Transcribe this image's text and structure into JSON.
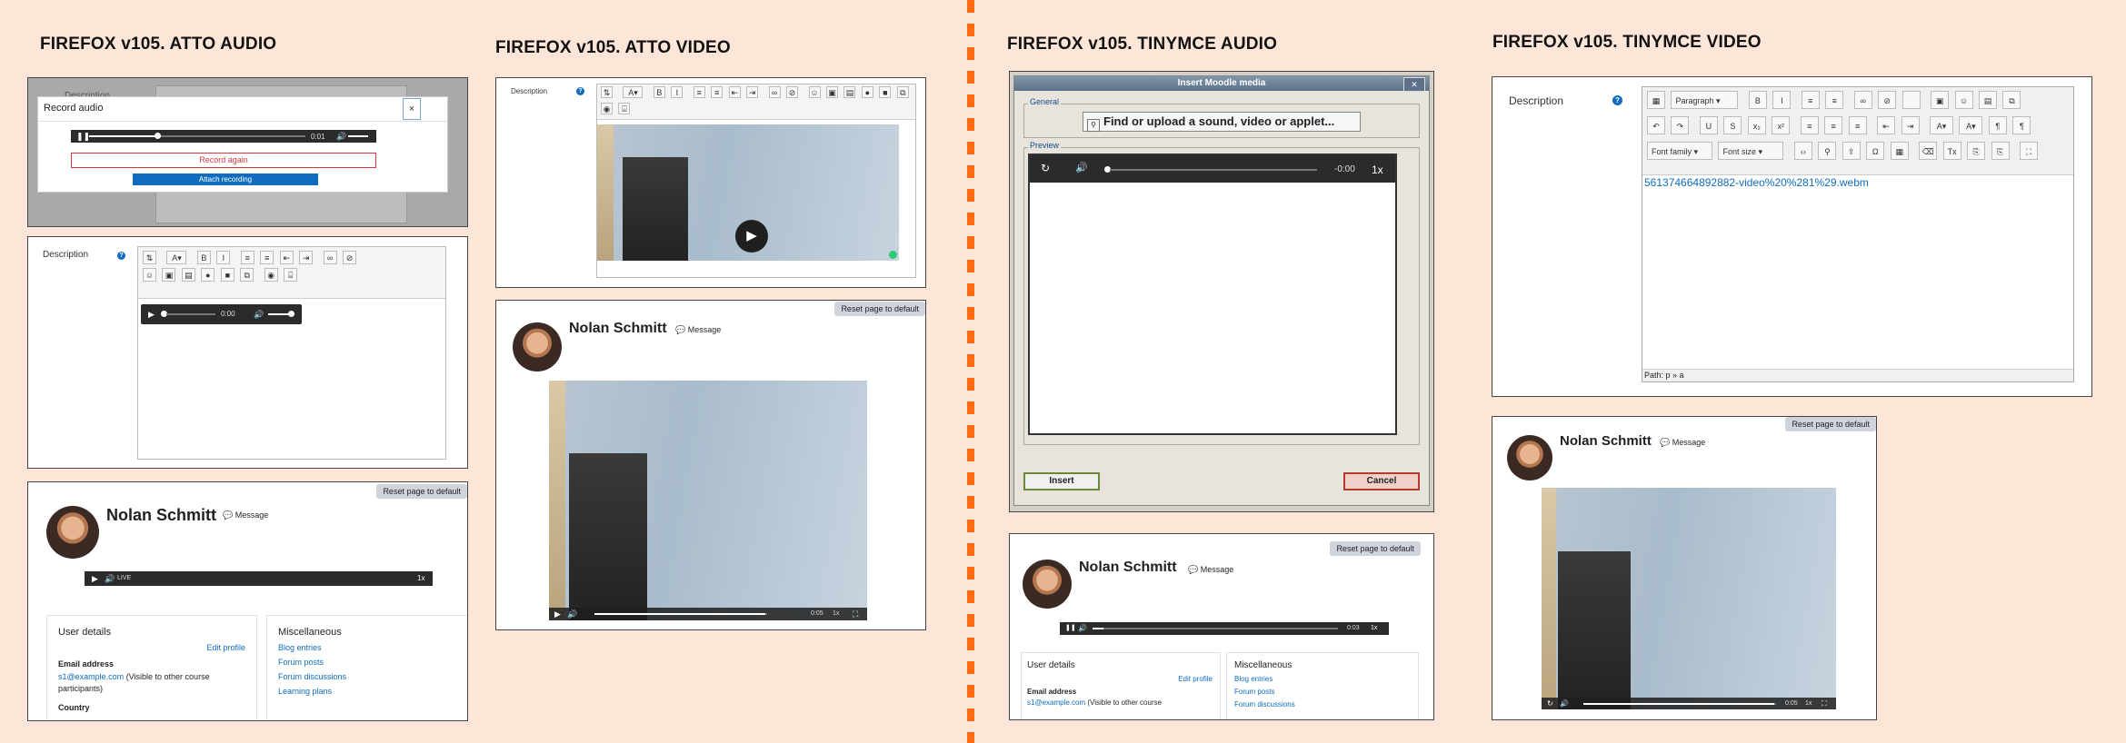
{
  "sections": {
    "atto_audio": "FIREFOX v105. ATTO AUDIO",
    "atto_video": "FIREFOX v105. ATTO VIDEO",
    "tiny_audio": "FIREFOX v105. TINYMCE AUDIO",
    "tiny_video": "FIREFOX v105. TINYMCE VIDEO"
  },
  "record_dialog": {
    "title": "Record audio",
    "close": "×",
    "time": "0:01",
    "record_again": "Record again",
    "attach": "Attach recording",
    "bg_label": "Description"
  },
  "atto_audio_editor": {
    "label": "Description",
    "help": "?",
    "player_time": "0:00"
  },
  "profile": {
    "name": "Nolan Schmitt",
    "message": "Message",
    "reset": "Reset page to default",
    "live": "LIVE",
    "speed": "1x",
    "user_details": "User details",
    "edit_profile": "Edit profile",
    "email_label": "Email address",
    "email": "s1@example.com",
    "email_note": "(Visible to other course participants)",
    "country": "Country",
    "misc": "Miscellaneous",
    "misc_links": [
      "Blog entries",
      "Forum posts",
      "Forum discussions",
      "Learning plans"
    ],
    "email_note_short": "(Visible to other course"
  },
  "atto_video_editor": {
    "label": "Description",
    "help": "?"
  },
  "video_player": {
    "time": "0:05",
    "speed": "1x",
    "progress": 0.62
  },
  "moodle_media": {
    "title": "Insert Moodle media",
    "close": "✕",
    "general": "General",
    "find_button": "Find or upload a sound, video or applet...",
    "preview": "Preview",
    "time": "-0:00",
    "speed": "1x",
    "insert": "Insert",
    "cancel": "Cancel"
  },
  "tiny_audio_profile_player": {
    "time": "0:03",
    "speed": "1x"
  },
  "tinymce_editor": {
    "label": "Description",
    "help": "?",
    "paragraph": "Paragraph",
    "font_family": "Font family",
    "font_size": "Font size",
    "content_link": "561374664892882-video%20%281%29.webm",
    "path": "Path: p » a"
  },
  "tiny_video_player": {
    "time": "0:05",
    "speed": "1x"
  },
  "colors": {
    "background": "#fde6d8",
    "divider": "#ff6a14",
    "link": "#0f6cbf",
    "record_again": "#d9363e",
    "attach": "#0f6cbf"
  }
}
